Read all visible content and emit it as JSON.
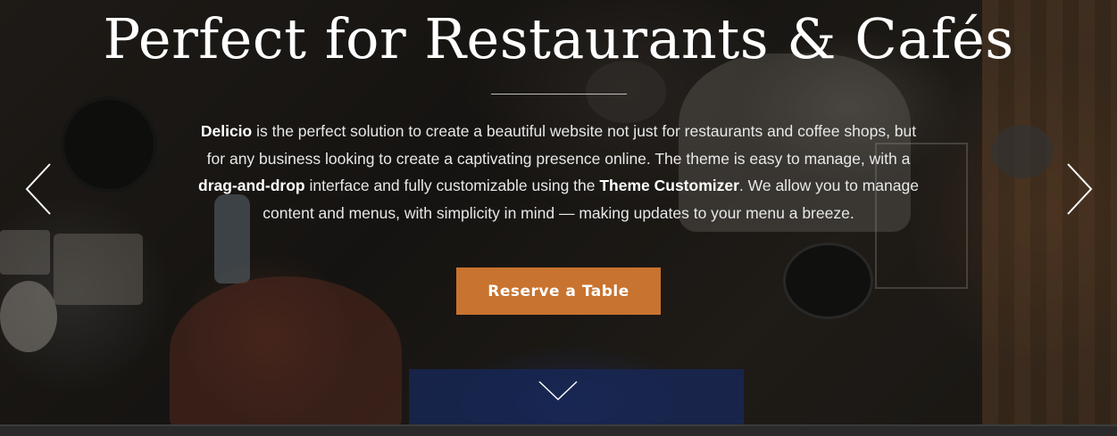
{
  "hero": {
    "title": "Perfect for Restaurants & Cafés",
    "description": {
      "brand": "Delicio",
      "part1": " is the perfect solution to create a beautiful website not just for restaurants and coffee shops, but for any business looking to create a captivating presence online. The theme is easy to manage, with a ",
      "bold2": "drag-and-drop",
      "part2": " interface and fully customizable using the ",
      "bold3": "Theme Customizer",
      "part3": ". We allow you to manage content and menus, with simplicity in mind — making updates to your menu a breeze."
    },
    "cta_label": "Reserve a Table",
    "accent_color": "#c8732f"
  },
  "slider": {
    "prev_icon": "chevron-left-icon",
    "next_icon": "chevron-right-icon",
    "scroll_icon": "chevron-down-icon"
  }
}
